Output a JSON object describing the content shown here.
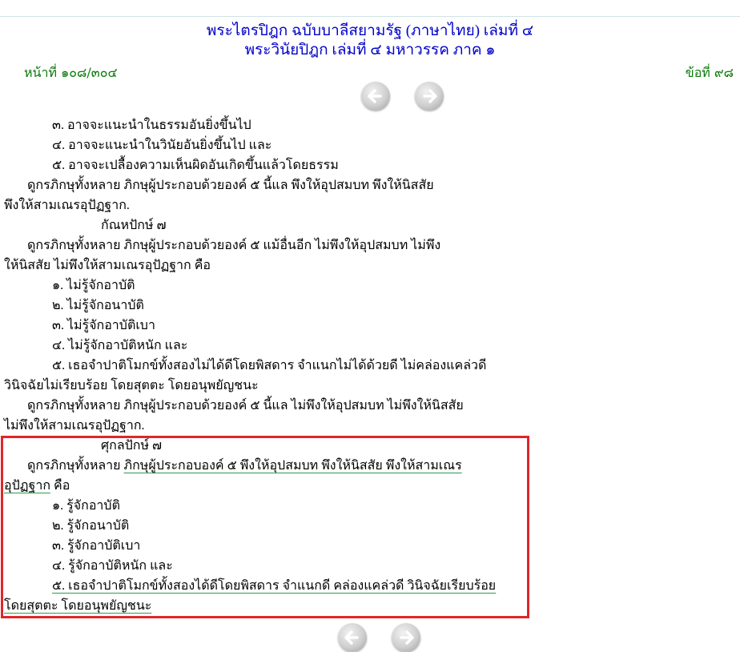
{
  "header": {
    "title_line1": "พระไตรปิฎก ฉบับบาลีสยามรัฐ (ภาษาไทย) เล่มที่ ๔",
    "title_line2": "พระวินัยปิฎก เล่มที่ ๔ มหาวรรค ภาค ๑",
    "page_label": "หน้าที่ ๑๐๘/๓๐๔",
    "item_label": "ข้อที่ ๙๘"
  },
  "nav": {
    "prev_icon": "arrow-left-icon",
    "next_icon": "arrow-right-icon"
  },
  "colors": {
    "title": "#0000cc",
    "page_meta": "#0a7a0a",
    "highlight_border": "#e0262b",
    "underline": "#2e9b4a"
  },
  "content": {
    "lines": [
      "๓. อาจจะแนะนำในธรรมอันยิ่งขึ้นไป",
      "๔. อาจจะแนะนำในวินัยอันยิ่งขึ้นไป และ",
      "๕. อาจจะเปลื้องความเห็นผิดอันเกิดขึ้นแล้วโดยธรรม",
      "ดูกรภิกษุทั้งหลาย ภิกษุผู้ประกอบด้วยองค์ ๕ นี้แล พึงให้อุปสมบท พึงให้นิสสัย",
      "พึงให้สามเณรอุปัฏฐาก.",
      "กัณหปักษ์ ๗",
      "ดูกรภิกษุทั้งหลาย ภิกษุผู้ประกอบด้วยองค์ ๕ แม้อื่นอีก ไม่พึงให้อุปสมบท ไม่พึง",
      "ให้นิสสัย ไม่พึงให้สามเณรอุปัฏฐาก คือ",
      "๑. ไม่รู้จักอาบัติ",
      "๒. ไม่รู้จักอนาบัติ",
      "๓. ไม่รู้จักอาบัติเบา",
      "๔. ไม่รู้จักอาบัติหนัก และ",
      "๕. เธอจำปาติโมกข์ทั้งสองไม่ได้ดีโดยพิสดาร จำแนกไม่ได้ด้วยดี ไม่คล่องแคล่วดี",
      "วินิจฉัยไม่เรียบร้อย โดยสุตตะ โดยอนุพยัญชนะ",
      "ดูกรภิกษุทั้งหลาย ภิกษุผู้ประกอบด้วยองค์ ๕ นี้แล ไม่พึงให้อุปสมบท ไม่พึงให้นิสสัย",
      "ไม่พึงให้สามเณรอุปัฏฐาก."
    ],
    "highlighted": {
      "heading": "ศุกลปักษ์ ๗",
      "line1_prefix": "ดูกรภิกษุทั้งหลาย",
      "line1_underlined": "ภิกษุผู้ประกอบองค์ ๕ พึงให้อุปสมบท พึงให้นิสสัย พึงให้สามเณร",
      "line2_underlined": "อุปัฏฐาก",
      "line2_suffix": "คือ",
      "items": [
        "๑. รู้จักอาบัติ",
        "๒. รู้จักอนาบัติ",
        "๓. รู้จักอาบัติเบา",
        "๔. รู้จักอาบัติหนัก และ"
      ],
      "item5": "๕. เธอจำปาติโมกข์ทั้งสองได้ดีโดยพิสดาร จำแนกดี คล่องแคล่วดี วินิจฉัยเรียบร้อย",
      "item5_cont": "โดยสุตตะ โดยอนุพยัญชนะ"
    }
  }
}
